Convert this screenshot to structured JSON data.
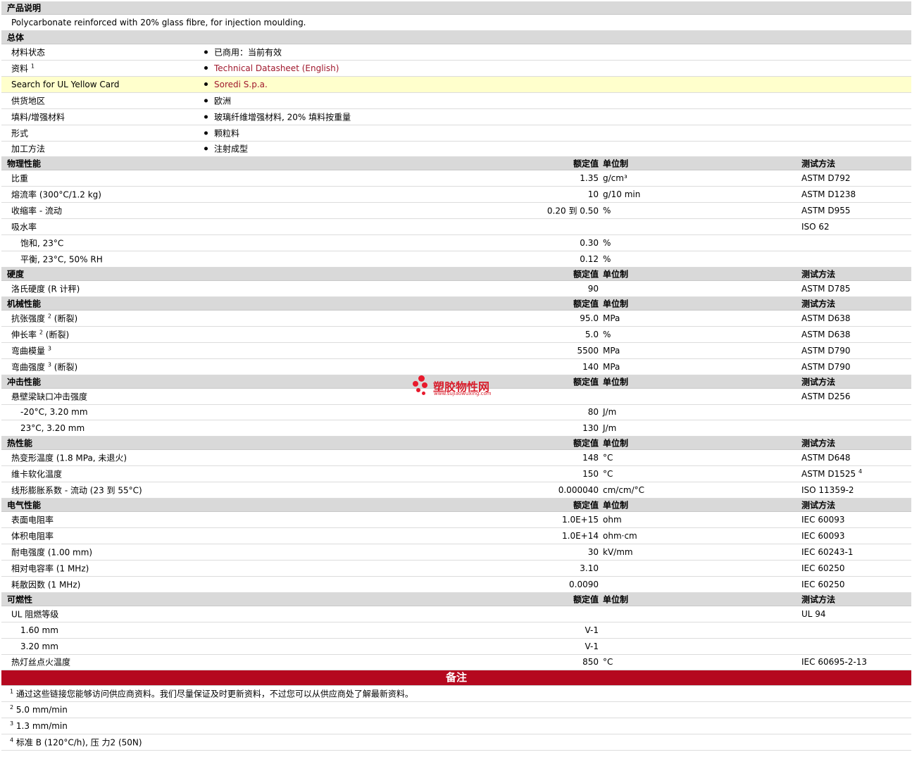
{
  "description": {
    "title": "产品说明",
    "text": "Polycarbonate reinforced with 20% glass fibre, for injection moulding."
  },
  "general": {
    "title": "总体",
    "rows": [
      {
        "label": "材料状态",
        "sup": "",
        "value": "已商用：当前有效",
        "link": false,
        "highlight": false
      },
      {
        "label": "资料",
        "sup": "1",
        "value": "Technical Datasheet (English)",
        "link": true,
        "highlight": false
      },
      {
        "label": "Search for UL Yellow Card",
        "sup": "",
        "value": "Soredi S.p.a.",
        "link": true,
        "highlight": true
      },
      {
        "label": "供货地区",
        "sup": "",
        "value": "欧洲",
        "link": false,
        "highlight": false
      },
      {
        "label": "填料/增强材料",
        "sup": "",
        "value": "玻璃纤维增强材料, 20% 填料按重量",
        "link": false,
        "highlight": false
      },
      {
        "label": "形式",
        "sup": "",
        "value": "颗粒料",
        "link": false,
        "highlight": false
      },
      {
        "label": "加工方法",
        "sup": "",
        "value": "注射成型",
        "link": false,
        "highlight": false
      }
    ]
  },
  "column_headers": {
    "value": "额定值",
    "unit": "单位制",
    "method": "测试方法"
  },
  "sections": [
    {
      "title": "物理性能",
      "rows": [
        {
          "label": "比重",
          "sup": "",
          "sub": false,
          "value": "1.35",
          "unit": "g/cm³",
          "method": "ASTM D792",
          "method_sup": ""
        },
        {
          "label": "熔流率  (300°C/1.2 kg)",
          "sup": "",
          "sub": false,
          "value": "10",
          "unit": "g/10 min",
          "method": "ASTM D1238",
          "method_sup": ""
        },
        {
          "label": "收缩率  - 流动",
          "sup": "",
          "sub": false,
          "value": "0.20 到  0.50",
          "unit": "%",
          "method": "ASTM D955",
          "method_sup": ""
        },
        {
          "label": "吸水率",
          "sup": "",
          "sub": false,
          "value": "",
          "unit": "",
          "method": "ISO 62",
          "method_sup": ""
        },
        {
          "label": "饱和, 23°C",
          "sup": "",
          "sub": true,
          "value": "0.30",
          "unit": "%",
          "method": "",
          "method_sup": ""
        },
        {
          "label": "平衡, 23°C, 50% RH",
          "sup": "",
          "sub": true,
          "value": "0.12",
          "unit": "%",
          "method": "",
          "method_sup": ""
        }
      ]
    },
    {
      "title": "硬度",
      "rows": [
        {
          "label": "洛氏硬度  (R 计秤)",
          "sup": "",
          "sub": false,
          "value": "90",
          "unit": "",
          "method": "ASTM D785",
          "method_sup": ""
        }
      ]
    },
    {
      "title": "机械性能",
      "rows": [
        {
          "label": "抗张强度",
          "sup": "2",
          "suffix": "(断裂)",
          "sub": false,
          "value": "95.0",
          "unit": "MPa",
          "method": "ASTM D638",
          "method_sup": ""
        },
        {
          "label": "伸长率",
          "sup": "2",
          "suffix": "(断裂)",
          "sub": false,
          "value": "5.0",
          "unit": "%",
          "method": "ASTM D638",
          "method_sup": ""
        },
        {
          "label": "弯曲模量",
          "sup": "3",
          "suffix": "",
          "sub": false,
          "value": "5500",
          "unit": "MPa",
          "method": "ASTM D790",
          "method_sup": ""
        },
        {
          "label": "弯曲强度",
          "sup": "3",
          "suffix": "(断裂)",
          "sub": false,
          "value": "140",
          "unit": "MPa",
          "method": "ASTM D790",
          "method_sup": ""
        }
      ]
    },
    {
      "title": "冲击性能",
      "rows": [
        {
          "label": "悬壁梁缺口冲击强度",
          "sup": "",
          "sub": false,
          "value": "",
          "unit": "",
          "method": "ASTM D256",
          "method_sup": ""
        },
        {
          "label": "-20°C, 3.20 mm",
          "sup": "",
          "sub": true,
          "value": "80",
          "unit": "J/m",
          "method": "",
          "method_sup": ""
        },
        {
          "label": "23°C, 3.20 mm",
          "sup": "",
          "sub": true,
          "value": "130",
          "unit": "J/m",
          "method": "",
          "method_sup": ""
        }
      ]
    },
    {
      "title": "热性能",
      "rows": [
        {
          "label": "热变形温度  (1.8 MPa, 未退火)",
          "sup": "",
          "sub": false,
          "value": "148",
          "unit": "°C",
          "method": "ASTM D648",
          "method_sup": ""
        },
        {
          "label": "维卡软化温度",
          "sup": "",
          "sub": false,
          "value": "150",
          "unit": "°C",
          "method": "ASTM D1525",
          "method_sup": "4"
        },
        {
          "label": "线形膨胀系数  - 流动  (23 到  55°C)",
          "sup": "",
          "sub": false,
          "value": "0.000040",
          "unit": "cm/cm/°C",
          "method": "ISO 11359-2",
          "method_sup": ""
        }
      ]
    },
    {
      "title": "电气性能",
      "rows": [
        {
          "label": "表面电阻率",
          "sup": "",
          "sub": false,
          "value": "1.0E+15",
          "unit": "ohm",
          "method": "IEC 60093",
          "method_sup": ""
        },
        {
          "label": "体积电阻率",
          "sup": "",
          "sub": false,
          "value": "1.0E+14",
          "unit": "ohm·cm",
          "method": "IEC 60093",
          "method_sup": ""
        },
        {
          "label": "耐电强度  (1.00 mm)",
          "sup": "",
          "sub": false,
          "value": "30",
          "unit": "kV/mm",
          "method": "IEC 60243-1",
          "method_sup": ""
        },
        {
          "label": "相对电容率  (1 MHz)",
          "sup": "",
          "sub": false,
          "value": "3.10",
          "unit": "",
          "method": "IEC 60250",
          "method_sup": ""
        },
        {
          "label": "耗散因数  (1 MHz)",
          "sup": "",
          "sub": false,
          "value": "0.0090",
          "unit": "",
          "method": "IEC 60250",
          "method_sup": ""
        }
      ]
    },
    {
      "title": "可燃性",
      "rows": [
        {
          "label": "UL 阻燃等级",
          "sup": "",
          "sub": false,
          "value": "",
          "unit": "",
          "method": "UL 94",
          "method_sup": ""
        },
        {
          "label": "1.60 mm",
          "sup": "",
          "sub": true,
          "value": "V-1",
          "unit": "",
          "method": "",
          "method_sup": ""
        },
        {
          "label": "3.20 mm",
          "sup": "",
          "sub": true,
          "value": "V-1",
          "unit": "",
          "method": "",
          "method_sup": ""
        },
        {
          "label": "热灯丝点火温度",
          "sup": "",
          "sub": false,
          "value": "850",
          "unit": "°C",
          "method": "IEC 60695-2-13",
          "method_sup": ""
        }
      ]
    }
  ],
  "notes": {
    "title": "备注",
    "items": [
      {
        "num": "1",
        "text": "通过这些链接您能够访问供应商资料。我们尽量保证及时更新资料，不过您可以从供应商处了解最新资料。"
      },
      {
        "num": "2",
        "text": "5.0 mm/min"
      },
      {
        "num": "3",
        "text": "1.3 mm/min"
      },
      {
        "num": "4",
        "text": "标准  B (120°C/h), 压  力2 (50N)"
      }
    ]
  },
  "watermark": {
    "name": "塑胶物性网",
    "url": "www.sujiaowuxing.com"
  },
  "colors": {
    "header_bg": "#d9d9d9",
    "notes_bg": "#b5081f",
    "link": "#a0182c",
    "highlight": "#ffffcc"
  }
}
